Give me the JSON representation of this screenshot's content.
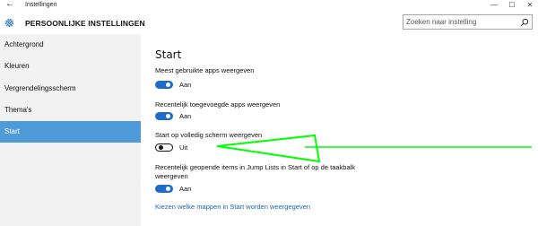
{
  "window": {
    "title": "Instellingen",
    "back_glyph": "←",
    "minimize_glyph": "—",
    "maximize_glyph": "☐",
    "close_glyph": "✕"
  },
  "header": {
    "title": "PERSOONLIJKE INSTELLINGEN",
    "icon": "gear-icon"
  },
  "search": {
    "placeholder": "Zoeken naar instelling",
    "value": "",
    "icon": "search-icon"
  },
  "sidebar": {
    "items": [
      {
        "label": "Achtergrond",
        "selected": false
      },
      {
        "label": "Kleuren",
        "selected": false
      },
      {
        "label": "Vergrendelingsscherm",
        "selected": false
      },
      {
        "label": "Thema's",
        "selected": false
      },
      {
        "label": "Start",
        "selected": true
      }
    ]
  },
  "main": {
    "title": "Start",
    "settings": [
      {
        "label": "Meest gebruikte apps weergeven",
        "state": "Aan",
        "on": true
      },
      {
        "label": "Recentelijk toegevoegde apps weergeven",
        "state": "Aan",
        "on": true
      },
      {
        "label": "Start op volledig scherm weergeven",
        "state": "Uit",
        "on": false
      },
      {
        "label": "Recentelijk geopende items in Jump Lists in Start of op de taakbalk weergeven",
        "state": "Aan",
        "on": true
      }
    ],
    "link": "Kiezen welke mappen in Start worden weergegeven"
  },
  "colors": {
    "accent": "#1e6cc8",
    "sidebar_selected": "#4f9ad9",
    "annotation_arrow": "#00ff00"
  }
}
